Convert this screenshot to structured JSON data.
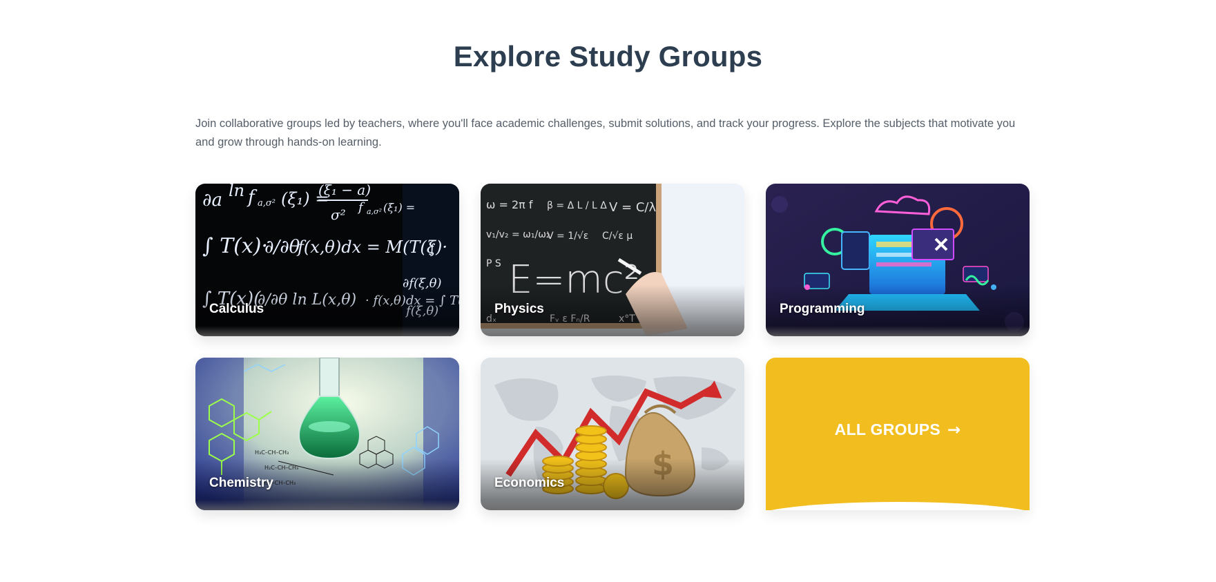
{
  "section": {
    "title": "Explore Study Groups",
    "intro": "Join collaborative groups led by teachers, where you'll face academic challenges, submit solutions, and track your progress. Explore the subjects that motivate you and grow through hands-on learning."
  },
  "groups": [
    {
      "label": "Calculus",
      "image_icon": "math-formulas-image"
    },
    {
      "label": "Physics",
      "image_icon": "chalkboard-emc2-image"
    },
    {
      "label": "Programming",
      "image_icon": "neon-laptop-image"
    },
    {
      "label": "Chemistry",
      "image_icon": "flask-molecules-image"
    },
    {
      "label": "Economics",
      "image_icon": "money-growth-chart-image"
    }
  ],
  "all_groups": {
    "label": "ALL GROUPS",
    "arrow": "→",
    "color": "#f2bd1e"
  },
  "colors": {
    "title": "#2c3e50",
    "text": "#555e68",
    "accent": "#f2bd1e"
  }
}
